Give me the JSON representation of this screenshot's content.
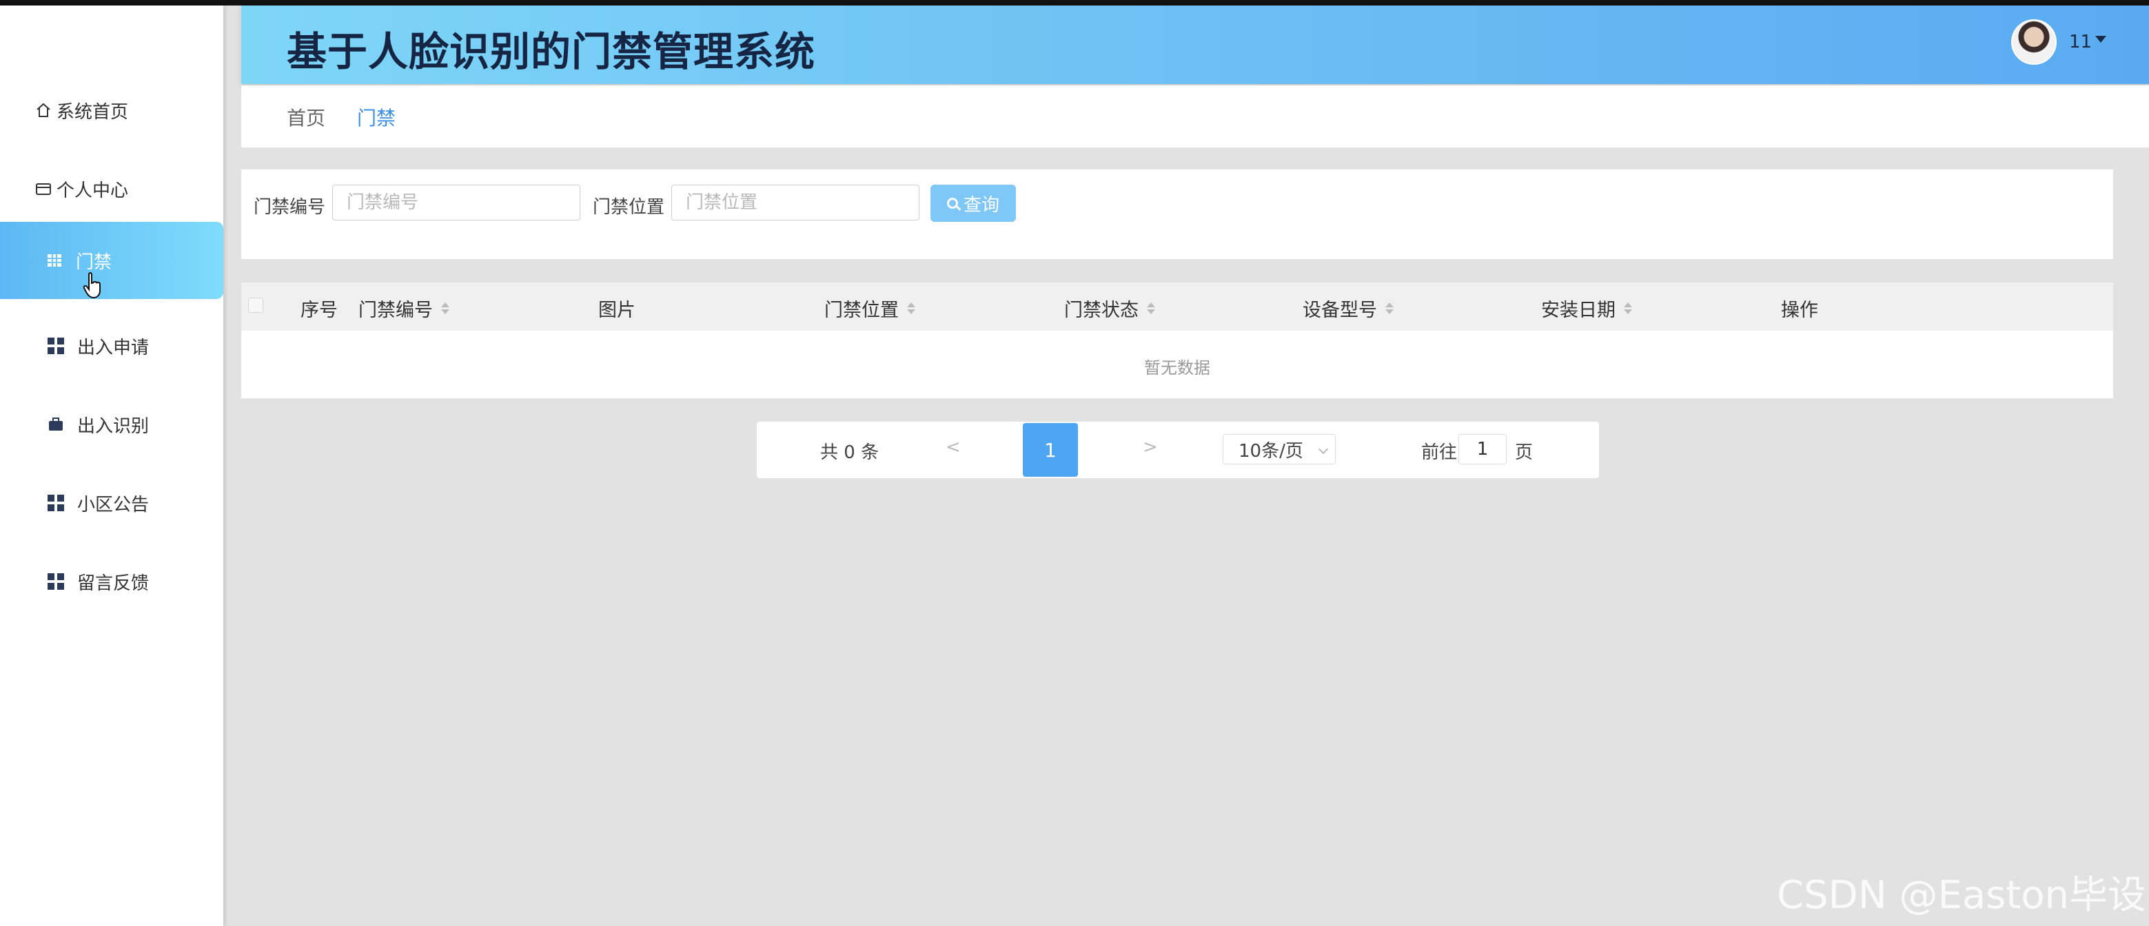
{
  "header": {
    "title": "基于人脸识别的门禁管理系统",
    "user": "11"
  },
  "sidebar": {
    "items": [
      {
        "label": "系统首页",
        "icon": "home-icon"
      },
      {
        "label": "个人中心",
        "icon": "card-icon"
      },
      {
        "label": "门禁",
        "icon": "grid-icon",
        "active": true
      },
      {
        "label": "出入申请",
        "icon": "grid-icon"
      },
      {
        "label": "出入识别",
        "icon": "briefcase-icon"
      },
      {
        "label": "小区公告",
        "icon": "grid-icon"
      },
      {
        "label": "留言反馈",
        "icon": "grid-icon"
      }
    ]
  },
  "breadcrumb": {
    "home": "首页",
    "current": "门禁"
  },
  "search": {
    "code_label": "门禁编号",
    "code_placeholder": "门禁编号",
    "location_label": "门禁位置",
    "location_placeholder": "门禁位置",
    "button": "查询"
  },
  "table": {
    "columns": [
      "序号",
      "门禁编号",
      "图片",
      "门禁位置",
      "门禁状态",
      "设备型号",
      "安装日期",
      "操作"
    ],
    "empty_text": "暂无数据"
  },
  "pagination": {
    "total": "共 0 条",
    "prev": "<",
    "current_page": "1",
    "next": ">",
    "page_size": "10条/页",
    "goto_prefix": "前往",
    "goto_value": "1",
    "goto_suffix": "页"
  },
  "watermark": "CSDN @Easton毕设"
}
